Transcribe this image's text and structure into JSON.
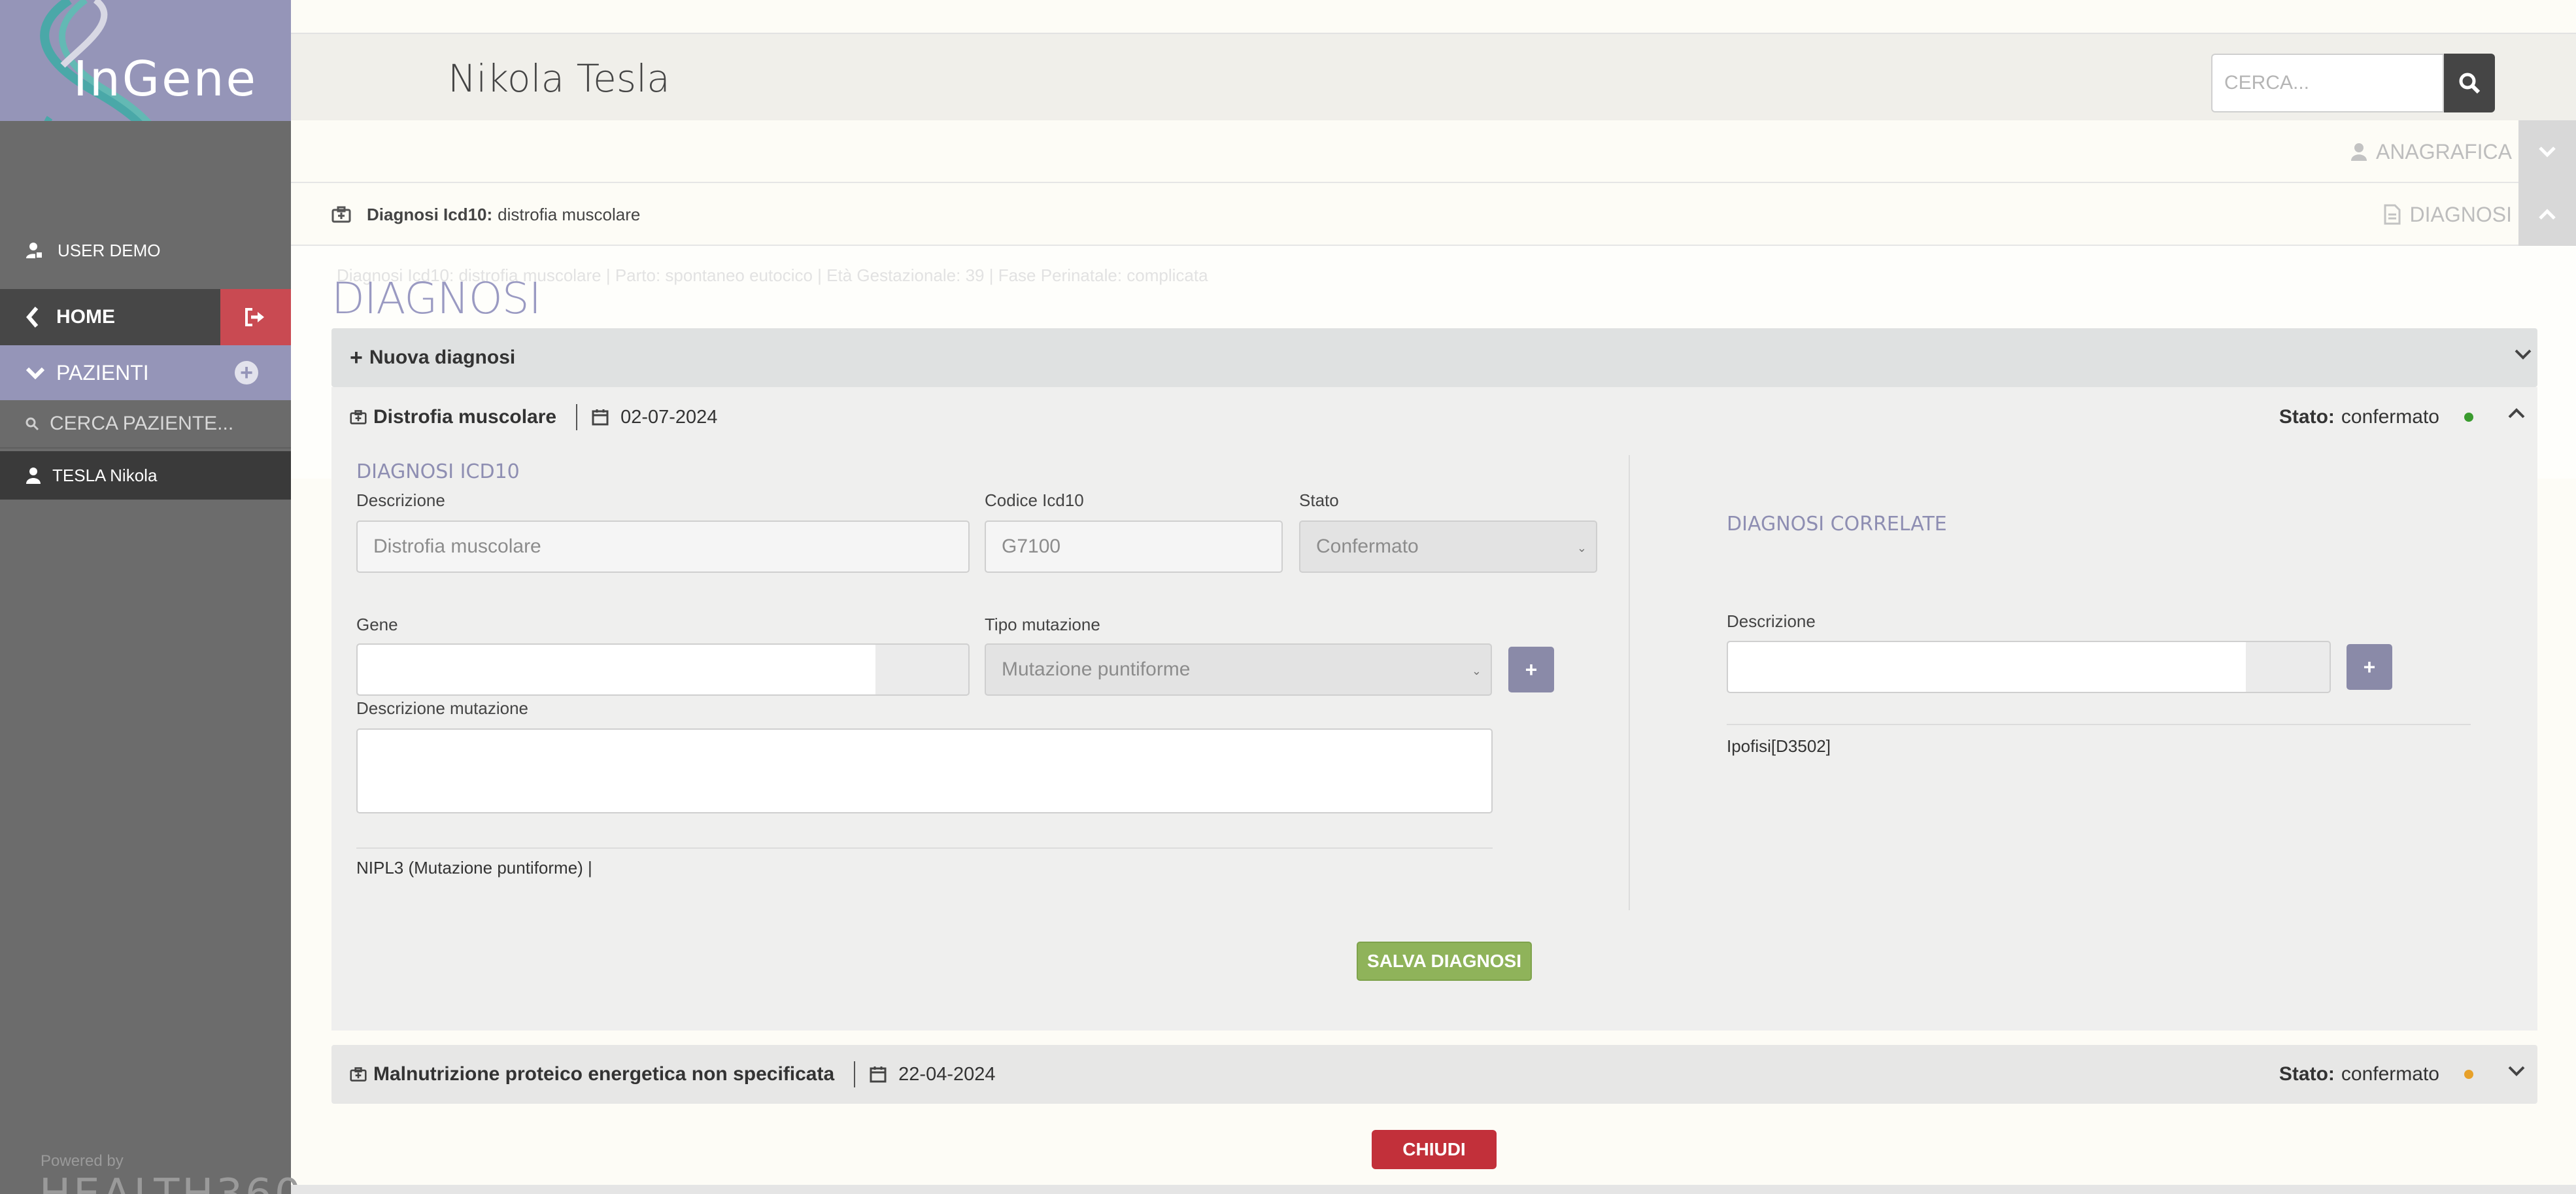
{
  "sidebar": {
    "logo_text": "InGene",
    "user_label": "USER DEMO",
    "home_label": "HOME",
    "pazienti_label": "PAZIENTI",
    "search_placeholder": "CERCA PAZIENTE...",
    "patient_label": "TESLA Nikola",
    "powered_by": "Powered by",
    "powered_logo": "HEALTH360"
  },
  "header": {
    "patient_name": "Nikola Tesla",
    "search_placeholder": "CERCA..."
  },
  "sections": {
    "anagrafica": "ANAGRAFICA",
    "diagnosi": "DIAGNOSI",
    "icd_label": "Diagnosi Icd10:",
    "icd_value": "distrofia muscolare"
  },
  "ghost_row": "Diagnosi Icd10: distrofia muscolare  |  Parto: spontaneo eutocico  |  Età Gestazionale: 39  |  Fase Perinatale: complicata",
  "page_title": "DIAGNOSI",
  "nuova_diagnosi": "Nuova diagnosi",
  "diagnosis_1": {
    "title": "Distrofia muscolare",
    "date": "02-07-2024",
    "state_label": "Stato:",
    "state_value": "confermato",
    "state_color": "#3a9b2e",
    "icd_section_title": "DIAGNOSI ICD10",
    "descrizione_label": "Descrizione",
    "descrizione_value": "Distrofia muscolare",
    "codice_label": "Codice Icd10",
    "codice_value": "G7100",
    "stato_label": "Stato",
    "stato_value": "Confermato",
    "gene_label": "Gene",
    "gene_value": "",
    "tipo_mutazione_label": "Tipo mutazione",
    "tipo_mutazione_value": "Mutazione puntiforme",
    "descrizione_mutazione_label": "Descrizione mutazione",
    "mutation_entry": "NIPL3 (Mutazione puntiforme) |",
    "correlate_title": "DIAGNOSI CORRELATE",
    "correlate_desc_label": "Descrizione",
    "correlate_entry": "Ipofisi[D3502]",
    "save_button": "SALVA DIAGNOSI"
  },
  "diagnosis_2": {
    "title": "Malnutrizione proteico energetica non specificata",
    "date": "22-04-2024",
    "state_label": "Stato:",
    "state_value": "confermato",
    "state_color": "#e7a12a"
  },
  "close_button": "CHIUDI"
}
